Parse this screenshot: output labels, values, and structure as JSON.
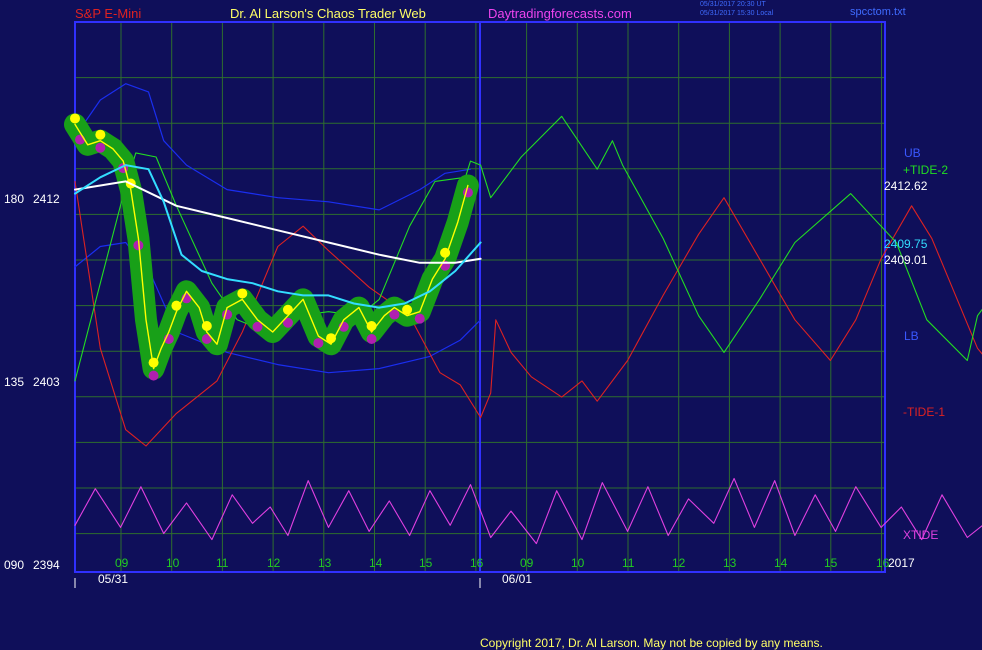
{
  "header": {
    "symbol": "S&P E-Mini",
    "title": "Dr. Al Larson's Chaos Trader Web",
    "site": "Daytradingforecasts.com",
    "time_ut": "05/31/2017 20:30 UT",
    "time_local": "05/31/2017 15:30 Local",
    "file": "spcctom.txt"
  },
  "colors": {
    "background": "#0f0f5a",
    "frame": "#3030ff",
    "grid": "#2e6e2e",
    "price": "#ffff00",
    "price_band": "#18a018",
    "price_marker": "#b020b0",
    "white_avg": "#ffffff",
    "cyan_avg": "#33ddff",
    "band": "#1a2ef0",
    "tide_plus": "#22dd22",
    "tide_minus": "#dd2222",
    "xtide": "#e040e0"
  },
  "y_axis": [
    {
      "left": "180",
      "right": "2412"
    },
    {
      "left": "135",
      "right": "2403"
    },
    {
      "left": "090",
      "right": "2394"
    }
  ],
  "x_axis": {
    "day1_hours": [
      "09",
      "10",
      "11",
      "12",
      "13",
      "14",
      "15",
      "16"
    ],
    "day2_hours": [
      "09",
      "10",
      "11",
      "12",
      "13",
      "14",
      "15",
      "16"
    ],
    "dates": [
      "05/31",
      "06/01"
    ],
    "year": "2017"
  },
  "labels": {
    "ub": "UB",
    "tide_plus": "+TIDE-2",
    "tide_plus_value": "2412.62",
    "cyan_value": "2409.75",
    "white_value": "2409.01",
    "lb": "LB",
    "tide_minus": "-TIDE-1",
    "xtide": "XTIDE"
  },
  "copyright": "Copyright 2017, Dr. Al Larson. May not be copied by any means.",
  "chart_data": {
    "type": "line",
    "title": "S&P E-Mini",
    "ylim": [
      2394,
      2418
    ],
    "x_unit": "hours elapsed from 08:30 on 05/31 (day 2 session starts at 8)",
    "price_close": [
      [
        0,
        2415.6
      ],
      [
        0.1,
        2415.2
      ],
      [
        0.25,
        2414.6
      ],
      [
        0.5,
        2414.8
      ],
      [
        0.75,
        2414.4
      ],
      [
        0.95,
        2413.8
      ],
      [
        1.1,
        2412.4
      ],
      [
        1.25,
        2410.0
      ],
      [
        1.4,
        2406.0
      ],
      [
        1.55,
        2403.6
      ],
      [
        1.7,
        2404.6
      ],
      [
        1.85,
        2405.4
      ],
      [
        2.0,
        2406.4
      ],
      [
        2.2,
        2407.4
      ],
      [
        2.45,
        2406.6
      ],
      [
        2.6,
        2405.4
      ],
      [
        2.8,
        2404.8
      ],
      [
        3.0,
        2406.6
      ],
      [
        3.3,
        2407.0
      ],
      [
        3.6,
        2406.0
      ],
      [
        3.9,
        2405.4
      ],
      [
        4.2,
        2406.2
      ],
      [
        4.5,
        2407.0
      ],
      [
        4.8,
        2405.2
      ],
      [
        5.05,
        2404.8
      ],
      [
        5.3,
        2406.0
      ],
      [
        5.6,
        2406.6
      ],
      [
        5.85,
        2405.4
      ],
      [
        6.1,
        2406.2
      ],
      [
        6.3,
        2406.6
      ],
      [
        6.55,
        2406.2
      ],
      [
        6.8,
        2406.4
      ],
      [
        7.05,
        2408.0
      ],
      [
        7.3,
        2409.0
      ],
      [
        7.55,
        2410.8
      ],
      [
        7.75,
        2412.6
      ]
    ],
    "white_avg": [
      [
        0,
        2412.4
      ],
      [
        1.0,
        2412.8
      ],
      [
        2.0,
        2411.6
      ],
      [
        3.0,
        2411.0
      ],
      [
        4.0,
        2410.4
      ],
      [
        5.0,
        2409.8
      ],
      [
        6.0,
        2409.2
      ],
      [
        6.8,
        2408.8
      ],
      [
        7.5,
        2408.8
      ],
      [
        8.0,
        2409.0
      ]
    ],
    "cyan_avg": [
      [
        0,
        2412.2
      ],
      [
        0.5,
        2413.0
      ],
      [
        1.0,
        2413.6
      ],
      [
        1.45,
        2413.4
      ],
      [
        1.75,
        2411.8
      ],
      [
        2.1,
        2409.2
      ],
      [
        2.5,
        2408.4
      ],
      [
        3.0,
        2408.0
      ],
      [
        3.5,
        2407.8
      ],
      [
        4.0,
        2407.4
      ],
      [
        4.5,
        2407.2
      ],
      [
        5.0,
        2407.2
      ],
      [
        5.5,
        2406.8
      ],
      [
        6.0,
        2406.6
      ],
      [
        6.5,
        2406.8
      ],
      [
        7.0,
        2407.4
      ],
      [
        7.5,
        2408.4
      ],
      [
        8.0,
        2409.8
      ]
    ],
    "upper_band": [
      [
        0,
        2415.0
      ],
      [
        0.5,
        2416.8
      ],
      [
        1.0,
        2417.6
      ],
      [
        1.45,
        2417.2
      ],
      [
        1.75,
        2414.8
      ],
      [
        2.2,
        2413.6
      ],
      [
        3.0,
        2412.4
      ],
      [
        3.5,
        2412.2
      ],
      [
        4.0,
        2412.0
      ],
      [
        5.0,
        2411.8
      ],
      [
        6.0,
        2411.4
      ],
      [
        6.8,
        2412.4
      ],
      [
        7.3,
        2413.2
      ],
      [
        7.8,
        2413.4
      ]
    ],
    "lower_band": [
      [
        0,
        2408.6
      ],
      [
        0.5,
        2409.6
      ],
      [
        1.0,
        2409.8
      ],
      [
        1.5,
        2408.2
      ],
      [
        2.0,
        2405.4
      ],
      [
        3.0,
        2404.4
      ],
      [
        4.0,
        2403.8
      ],
      [
        5.0,
        2403.4
      ],
      [
        6.0,
        2403.6
      ],
      [
        7.0,
        2404.2
      ],
      [
        7.6,
        2405.0
      ],
      [
        8.0,
        2406.0
      ]
    ],
    "tide_plus": [
      [
        0,
        2403.0
      ],
      [
        0.5,
        2407.8
      ],
      [
        1.0,
        2412.6
      ],
      [
        1.2,
        2414.2
      ],
      [
        1.6,
        2414.0
      ],
      [
        2.0,
        2411.6
      ],
      [
        2.7,
        2407.8
      ],
      [
        3.2,
        2406.0
      ],
      [
        3.8,
        2405.4
      ],
      [
        4.4,
        2406.2
      ],
      [
        5.0,
        2406.4
      ],
      [
        5.6,
        2406.2
      ],
      [
        6.0,
        2407.0
      ],
      [
        6.6,
        2410.6
      ],
      [
        7.1,
        2412.8
      ],
      [
        7.7,
        2413.0
      ],
      [
        7.8,
        2413.8
      ],
      [
        8.0,
        2413.6
      ],
      [
        8.2,
        2412.0
      ],
      [
        8.8,
        2414.0
      ],
      [
        9.6,
        2416.0
      ],
      [
        10.3,
        2413.4
      ],
      [
        10.6,
        2414.8
      ],
      [
        10.8,
        2413.6
      ],
      [
        11.6,
        2410.0
      ],
      [
        12.3,
        2406.2
      ],
      [
        12.8,
        2404.4
      ],
      [
        13.5,
        2407.0
      ],
      [
        14.2,
        2409.8
      ],
      [
        15.3,
        2412.2
      ],
      [
        16.2,
        2409.8
      ],
      [
        16.8,
        2406.0
      ],
      [
        17.6,
        2404.0
      ],
      [
        17.8,
        2406.2
      ],
      [
        18.4,
        2408.2
      ],
      [
        18.9,
        2410.2
      ],
      [
        19.2,
        2413.0
      ],
      [
        19.4,
        2413.4
      ]
    ],
    "tide_minus": [
      [
        0,
        2412.8
      ],
      [
        0.5,
        2404.6
      ],
      [
        1.0,
        2400.6
      ],
      [
        1.4,
        2399.8
      ],
      [
        2.0,
        2401.4
      ],
      [
        2.8,
        2403.0
      ],
      [
        3.3,
        2405.4
      ],
      [
        4.0,
        2409.6
      ],
      [
        4.5,
        2410.6
      ],
      [
        5.0,
        2409.4
      ],
      [
        5.8,
        2407.6
      ],
      [
        6.6,
        2406.2
      ],
      [
        7.2,
        2403.4
      ],
      [
        7.6,
        2402.8
      ],
      [
        8.0,
        2401.2
      ],
      [
        8.2,
        2402.4
      ],
      [
        8.3,
        2406.0
      ],
      [
        8.6,
        2404.4
      ],
      [
        9.0,
        2403.2
      ],
      [
        9.6,
        2402.2
      ],
      [
        10.0,
        2403.0
      ],
      [
        10.3,
        2402.0
      ],
      [
        10.9,
        2404.0
      ],
      [
        11.6,
        2407.2
      ],
      [
        12.3,
        2410.2
      ],
      [
        12.8,
        2412.0
      ],
      [
        13.5,
        2409.0
      ],
      [
        14.2,
        2406.0
      ],
      [
        14.9,
        2404.0
      ],
      [
        15.4,
        2406.0
      ],
      [
        15.9,
        2409.0
      ],
      [
        16.5,
        2411.6
      ],
      [
        16.9,
        2410.0
      ],
      [
        17.4,
        2407.0
      ],
      [
        17.8,
        2404.6
      ],
      [
        18.2,
        2403.4
      ],
      [
        18.7,
        2402.6
      ]
    ],
    "xtide": [
      [
        0,
        2395.9
      ],
      [
        0.4,
        2397.7
      ],
      [
        0.9,
        2395.8
      ],
      [
        1.3,
        2397.8
      ],
      [
        1.75,
        2395.5
      ],
      [
        2.2,
        2397.0
      ],
      [
        2.7,
        2395.2
      ],
      [
        3.1,
        2397.4
      ],
      [
        3.5,
        2396.0
      ],
      [
        3.85,
        2396.8
      ],
      [
        4.2,
        2395.4
      ],
      [
        4.6,
        2398.1
      ],
      [
        5.0,
        2395.8
      ],
      [
        5.4,
        2397.6
      ],
      [
        5.8,
        2395.6
      ],
      [
        6.2,
        2397.1
      ],
      [
        6.6,
        2395.4
      ],
      [
        7.0,
        2397.6
      ],
      [
        7.4,
        2395.9
      ],
      [
        7.8,
        2397.9
      ],
      [
        8.2,
        2395.3
      ],
      [
        8.6,
        2396.6
      ],
      [
        9.1,
        2395.0
      ],
      [
        9.5,
        2397.6
      ],
      [
        10.0,
        2395.2
      ],
      [
        10.4,
        2398.0
      ],
      [
        10.9,
        2395.6
      ],
      [
        11.3,
        2397.8
      ],
      [
        11.7,
        2395.4
      ],
      [
        12.1,
        2397.2
      ],
      [
        12.6,
        2396.0
      ],
      [
        13.0,
        2398.2
      ],
      [
        13.4,
        2395.8
      ],
      [
        13.8,
        2398.1
      ],
      [
        14.2,
        2395.4
      ],
      [
        14.6,
        2397.4
      ],
      [
        15.0,
        2395.6
      ],
      [
        15.4,
        2397.8
      ],
      [
        15.9,
        2395.8
      ],
      [
        16.3,
        2396.8
      ],
      [
        16.7,
        2395.2
      ],
      [
        17.1,
        2397.4
      ],
      [
        17.6,
        2395.3
      ],
      [
        18.0,
        2396.1
      ],
      [
        18.4,
        2395.1
      ],
      [
        18.7,
        2395.8
      ]
    ]
  }
}
